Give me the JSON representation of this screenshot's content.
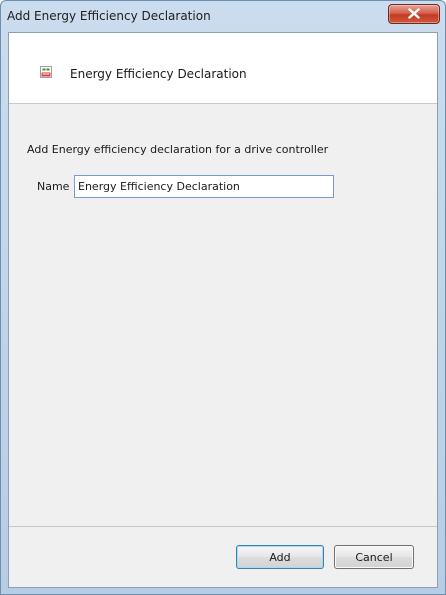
{
  "window": {
    "title": "Add Energy Efficiency Declaration",
    "close_icon": "close-icon"
  },
  "header": {
    "icon": "xml-document-icon",
    "title": "Energy Efficiency Declaration"
  },
  "form": {
    "description": "Add Energy efficiency declaration for a drive controller",
    "name_label": "Name",
    "name_value": "Energy Efficiency Declaration"
  },
  "footer": {
    "add_label": "Add",
    "cancel_label": "Cancel"
  },
  "colors": {
    "titlebar": "#cbdcee",
    "close_button": "#c23a24",
    "client_background": "#f0f0f0",
    "default_button_border": "#3c7fb1"
  }
}
